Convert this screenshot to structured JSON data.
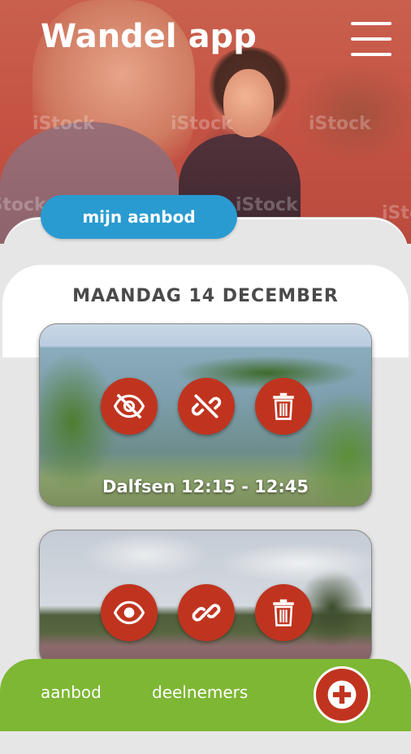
{
  "header": {
    "title": "Wandel app",
    "menu_icon": "hamburger-menu-icon",
    "watermark": "iStock"
  },
  "section_tab": {
    "label": "mijn aanbod"
  },
  "day": {
    "heading": "MAANDAG 14 DECEMBER"
  },
  "walks": [
    {
      "label": "Dalfsen 12:15 - 12:45",
      "actions": {
        "visibility_icon": "eye-off-icon",
        "link_icon": "link-off-icon",
        "delete_icon": "trash-icon"
      }
    },
    {
      "label": "",
      "actions": {
        "visibility_icon": "eye-icon",
        "link_icon": "link-icon",
        "delete_icon": "trash-icon"
      }
    }
  ],
  "bottom_nav": {
    "items": [
      {
        "label": "aanbod"
      },
      {
        "label": "deelnemers"
      }
    ],
    "add_icon": "plus-icon"
  },
  "colors": {
    "brand_blue": "#2a9bd1",
    "action_red": "#c0341f",
    "nav_green": "#7db733",
    "hero_overlay": "#c65445"
  }
}
